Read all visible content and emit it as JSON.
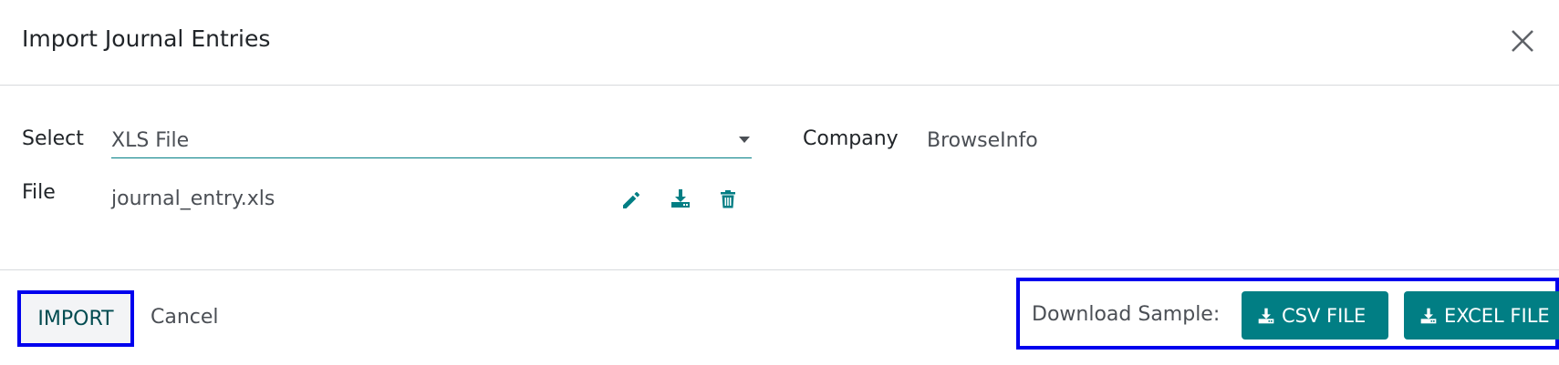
{
  "dialog": {
    "title": "Import Journal Entries",
    "close_icon": "close-icon"
  },
  "form": {
    "select_label": "Select",
    "select_value": "XLS File",
    "file_label": "File",
    "file_value": "journal_entry.xls",
    "file_icons": [
      "pencil-icon",
      "download-icon",
      "trash-icon"
    ],
    "company_label": "Company",
    "company_value": "BrowseInfo"
  },
  "footer": {
    "import_label": "IMPORT",
    "cancel_label": "Cancel",
    "download_sample_label": "Download Sample:",
    "csv_button_label": "CSV FILE",
    "excel_button_label": "EXCEL FILE"
  },
  "colors": {
    "accent": "#017e84",
    "highlight_border": "#0000ee",
    "text": "#212529",
    "muted_text": "#4b4f55"
  }
}
